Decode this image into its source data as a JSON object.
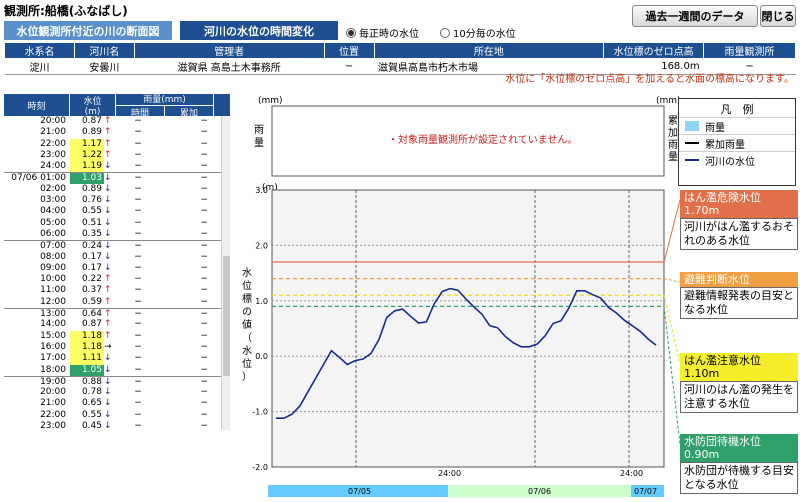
{
  "header": {
    "title": "観測所:船橋(ふなばし)",
    "btn_week": "過去一週間のデータ",
    "btn_close": "閉じる"
  },
  "tabs": [
    {
      "label": "水位観測所付近の川の断面図"
    },
    {
      "label": "河川の水位の時間変化"
    }
  ],
  "radios": [
    {
      "label": "毎正時の水位",
      "checked": true
    },
    {
      "label": "10分毎の水位",
      "checked": false
    }
  ],
  "info": {
    "headers": [
      "水系名",
      "河川名",
      "管理者",
      "位置",
      "所在地",
      "水位標のゼロ点高",
      "雨量観測所"
    ],
    "values": [
      "淀川",
      "安曇川",
      "滋賀県 高島土木事務所",
      "−",
      "滋賀県高島市朽木市場",
      "168.0m",
      "−"
    ]
  },
  "note": "水位に「水位標のゼロ点高」を加えると水面の標高になります。",
  "left_table": {
    "h_time": "時刻",
    "h_level": "水位",
    "h_level_unit": "(m)",
    "h_rain": "雨量(mm)",
    "h_rain_time": "時間",
    "h_rain_cum": "累加",
    "rows": [
      {
        "t": "20:00",
        "v": "0.87",
        "a": "↑",
        "r1": "−",
        "r2": "−",
        "c": ""
      },
      {
        "t": "21:00",
        "v": "0.89",
        "a": "↑",
        "r1": "−",
        "r2": "−",
        "c": ""
      },
      {
        "t": "22:00",
        "v": "1.17",
        "a": "↑",
        "r1": "−",
        "r2": "−",
        "c": "yl"
      },
      {
        "t": "23:00",
        "v": "1.22",
        "a": "↑",
        "r1": "−",
        "r2": "−",
        "c": "yl"
      },
      {
        "t": "24:00",
        "v": "1.19",
        "a": "↓",
        "r1": "−",
        "r2": "−",
        "c": "yl"
      },
      {
        "t": "07/06 01:00",
        "v": "1.03",
        "a": "↓",
        "r1": "−",
        "r2": "−",
        "c": "gr",
        "sep": true
      },
      {
        "t": "02:00",
        "v": "0.89",
        "a": "↓",
        "r1": "−",
        "r2": "−",
        "c": ""
      },
      {
        "t": "03:00",
        "v": "0.76",
        "a": "↓",
        "r1": "−",
        "r2": "−",
        "c": ""
      },
      {
        "t": "04:00",
        "v": "0.55",
        "a": "↓",
        "r1": "−",
        "r2": "−",
        "c": ""
      },
      {
        "t": "05:00",
        "v": "0.51",
        "a": "↓",
        "r1": "−",
        "r2": "−",
        "c": ""
      },
      {
        "t": "06:00",
        "v": "0.35",
        "a": "↓",
        "r1": "−",
        "r2": "−",
        "c": ""
      },
      {
        "t": "07:00",
        "v": "0.24",
        "a": "↓",
        "r1": "−",
        "r2": "−",
        "c": "",
        "sep": true
      },
      {
        "t": "08:00",
        "v": "0.17",
        "a": "↓",
        "r1": "−",
        "r2": "−",
        "c": ""
      },
      {
        "t": "09:00",
        "v": "0.17",
        "a": "↓",
        "r1": "−",
        "r2": "−",
        "c": ""
      },
      {
        "t": "10:00",
        "v": "0.22",
        "a": "↑",
        "r1": "−",
        "r2": "−",
        "c": ""
      },
      {
        "t": "11:00",
        "v": "0.37",
        "a": "↑",
        "r1": "−",
        "r2": "−",
        "c": ""
      },
      {
        "t": "12:00",
        "v": "0.59",
        "a": "↑",
        "r1": "−",
        "r2": "−",
        "c": ""
      },
      {
        "t": "13:00",
        "v": "0.64",
        "a": "↑",
        "r1": "−",
        "r2": "−",
        "c": "",
        "sep": true
      },
      {
        "t": "14:00",
        "v": "0.87",
        "a": "↑",
        "r1": "−",
        "r2": "−",
        "c": ""
      },
      {
        "t": "15:00",
        "v": "1.18",
        "a": "↑",
        "r1": "−",
        "r2": "−",
        "c": "yl"
      },
      {
        "t": "16:00",
        "v": "1.18",
        "a": "→",
        "r1": "−",
        "r2": "−",
        "c": "yl"
      },
      {
        "t": "17:00",
        "v": "1.11",
        "a": "↓",
        "r1": "−",
        "r2": "−",
        "c": "yl"
      },
      {
        "t": "18:00",
        "v": "1.05",
        "a": "↓",
        "r1": "−",
        "r2": "−",
        "c": "gr"
      },
      {
        "t": "19:00",
        "v": "0.88",
        "a": "↓",
        "r1": "−",
        "r2": "−",
        "c": "",
        "sep": true
      },
      {
        "t": "20:00",
        "v": "0.78",
        "a": "↓",
        "r1": "−",
        "r2": "−",
        "c": ""
      },
      {
        "t": "21:00",
        "v": "0.65",
        "a": "↓",
        "r1": "−",
        "r2": "−",
        "c": ""
      },
      {
        "t": "22:00",
        "v": "0.55",
        "a": "↓",
        "r1": "−",
        "r2": "−",
        "c": ""
      },
      {
        "t": "23:00",
        "v": "0.45",
        "a": "↓",
        "r1": "−",
        "r2": "−",
        "c": ""
      },
      {
        "t": "24:00",
        "v": "0.31",
        "a": "↓",
        "r1": "−",
        "r2": "−",
        "c": ""
      },
      {
        "t": "07/07 01:00",
        "v": "0.20",
        "a": "↓",
        "r1": "−",
        "r2": "−",
        "c": "",
        "sep": true
      }
    ]
  },
  "rain_panel": {
    "left_unit": "(mm)",
    "right_unit": "(mm)",
    "left_label": "雨量",
    "right_label": "累加雨量",
    "message": "・対象雨量観測所が設定されていません。"
  },
  "chart_data": {
    "type": "line",
    "ylabel": "水位標の値（水位）",
    "yunit": "(m)",
    "ylim": [
      -2.0,
      3.0
    ],
    "yticks": [
      "3.0",
      "2.0",
      "1.0",
      "0.0",
      "-1.0",
      "-2.0"
    ],
    "xtick_label": "24:00",
    "dates": [
      "07/05",
      "07/06",
      "07/07"
    ],
    "series": [
      {
        "name": "河川の水位",
        "color": "#1a2a8c",
        "values": [
          -1.12,
          -1.12,
          -1.05,
          -0.9,
          -0.65,
          -0.4,
          -0.15,
          0.1,
          -0.02,
          -0.15,
          -0.08,
          -0.05,
          0.05,
          0.3,
          0.7,
          0.82,
          0.85,
          0.72,
          0.6,
          0.62,
          0.95,
          1.17,
          1.22,
          1.19,
          1.03,
          0.89,
          0.76,
          0.55,
          0.51,
          0.35,
          0.24,
          0.17,
          0.17,
          0.22,
          0.37,
          0.59,
          0.64,
          0.87,
          1.18,
          1.18,
          1.11,
          1.05,
          0.88,
          0.78,
          0.65,
          0.55,
          0.45,
          0.31,
          0.2
        ]
      }
    ],
    "thresholds": [
      {
        "value": 1.7,
        "color": "#e0704a"
      },
      {
        "value": 1.4,
        "color": "#f0a040"
      },
      {
        "value": 1.1,
        "color": "#e8e020"
      },
      {
        "value": 0.9,
        "color": "#2fa06a"
      }
    ]
  },
  "legend": {
    "title": "凡　例",
    "items": [
      {
        "label": "雨量"
      },
      {
        "label": "累加雨量"
      },
      {
        "label": "河川の水位"
      }
    ]
  },
  "tags": [
    {
      "h": "はん濫危険水位",
      "v": "1.70m",
      "d": "河川がはん濫するおそれのある水位",
      "color": "#e0704a"
    },
    {
      "h": "避難判断水位",
      "v": "",
      "d": "避難情報発表の目安となる水位",
      "color": "#f0a040"
    },
    {
      "h": "はん濫注意水位",
      "v": "1.10m",
      "d": "河川のはん濫の発生を注意する水位",
      "color": "#f5ee2a"
    },
    {
      "h": "水防団待機水位",
      "v": "0.90m",
      "d": "水防団が待機する目安となる水位",
      "color": "#2fa06a"
    }
  ]
}
